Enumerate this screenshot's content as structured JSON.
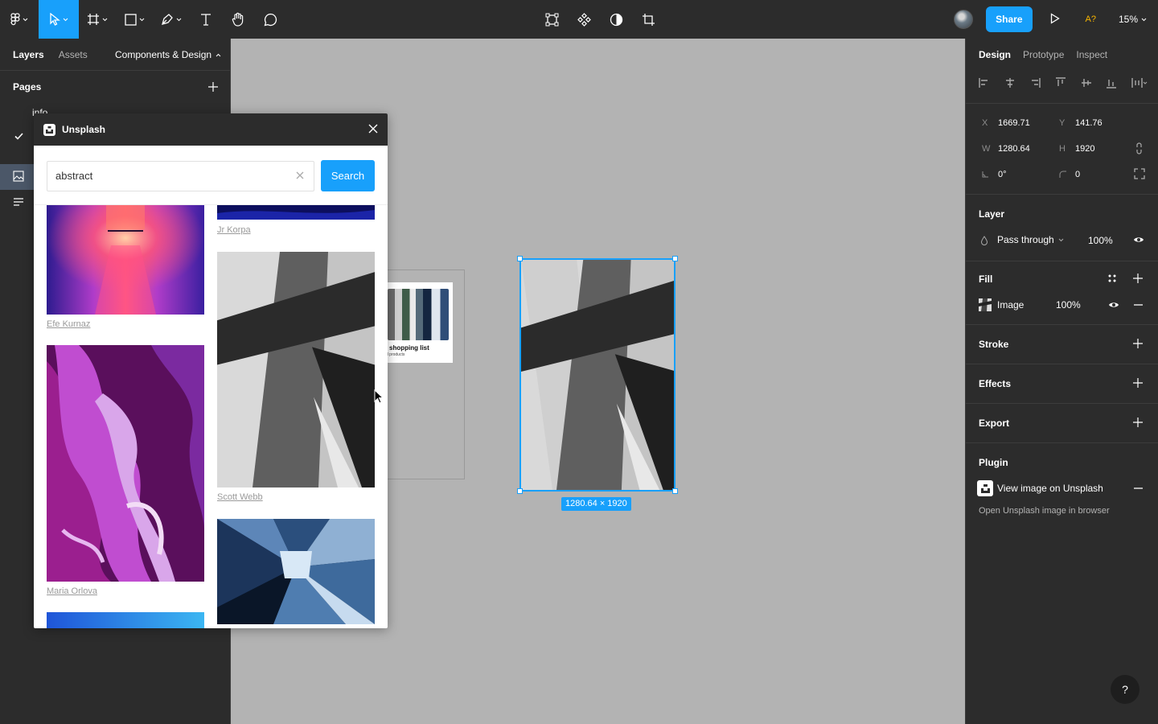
{
  "toolbar": {
    "share_label": "Share",
    "account_badge": "A?",
    "zoom_level": "15%"
  },
  "left_panel": {
    "tabs": [
      "Layers",
      "Assets"
    ],
    "components_label": "Components & Design",
    "pages_title": "Pages",
    "page_items": [
      "info"
    ]
  },
  "plugin": {
    "title": "Unsplash",
    "search_value": "abstract",
    "search_button": "Search",
    "credits": {
      "efe": "Efe Kurnaz",
      "jr": "Jr Korpa",
      "maria": "Maria Orlova",
      "scott": "Scott Webb"
    }
  },
  "canvas": {
    "card_title": "shopping list",
    "card_subtitle": "d products",
    "dimension_badge": "1280.64 × 1920"
  },
  "right_panel": {
    "tabs": [
      "Design",
      "Prototype",
      "Inspect"
    ],
    "x_label": "X",
    "x_value": "1669.71",
    "y_label": "Y",
    "y_value": "141.76",
    "w_label": "W",
    "w_value": "1280.64",
    "h_label": "H",
    "h_value": "1920",
    "rotation_value": "0°",
    "radius_value": "0",
    "layer_title": "Layer",
    "blend_mode": "Pass through",
    "layer_opacity": "100%",
    "fill_title": "Fill",
    "fill_type": "Image",
    "fill_opacity": "100%",
    "stroke_title": "Stroke",
    "effects_title": "Effects",
    "export_title": "Export",
    "plugin_title": "Plugin",
    "plugin_action": "View image on Unsplash",
    "plugin_action_desc": "Open Unsplash image in browser",
    "help_label": "?"
  },
  "colors": {
    "accent": "#18a0fb",
    "panel_bg": "#2c2c2c",
    "canvas_bg": "#b3b3b3",
    "badge_yellow": "#f7b500"
  }
}
